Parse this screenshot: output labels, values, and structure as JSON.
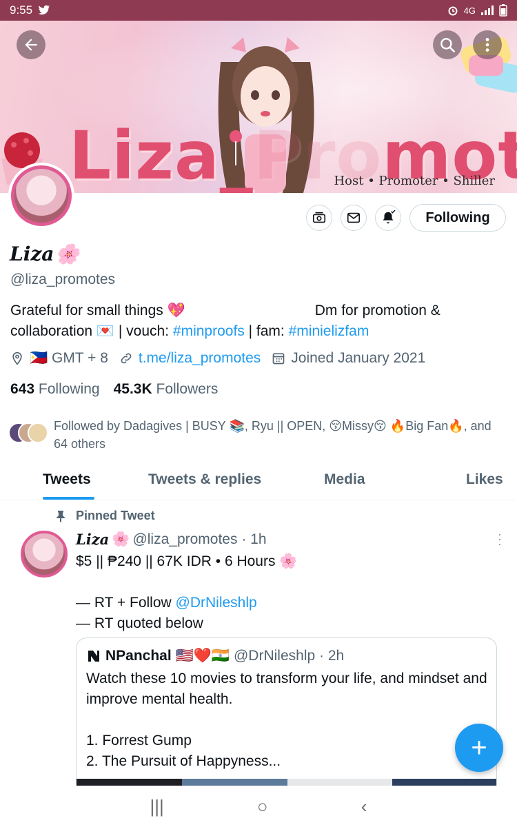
{
  "status_bar": {
    "time": "9:55",
    "network": "4G",
    "colors": {
      "bar": "#8e3a52"
    }
  },
  "banner": {
    "title": "Liza_Promotes",
    "title_left": "Liza_",
    "title_right": "motes",
    "tagline": "Host • Promoter • Shiller",
    "icons": [
      "back-arrow-icon",
      "search-icon",
      "more-vertical-icon"
    ]
  },
  "profile": {
    "display_name": "Liza",
    "name_emoji": "🌸",
    "handle": "@liza_promotes",
    "follow_button": "Following",
    "bio": {
      "part1": "Grateful for small things 💖",
      "part2": "Dm for promotion & collaboration 💌 | vouch: ",
      "hashtag1": "#minproofs",
      "part3": " | fam: ",
      "hashtag2": "#minielizfam"
    },
    "location": "🇵🇭 GMT + 8",
    "website": "t.me/liza_promotes",
    "joined": "Joined January 2021",
    "following_count": "643",
    "following_label": "Following",
    "followers_count": "45.3K",
    "followers_label": "Followers",
    "followed_by": "Followed by Dadagives | BUSY 📚, Ryu || OPEN, 😚Missy😚 🔥Big Fan🔥, and 64 others"
  },
  "tabs": [
    {
      "label": "Tweets",
      "active": true
    },
    {
      "label": "Tweets & replies",
      "active": false
    },
    {
      "label": "Media",
      "active": false
    },
    {
      "label": "Likes",
      "active": false
    }
  ],
  "pinned_tweet": {
    "pinned_label": "Pinned Tweet",
    "name": "Liza",
    "name_emoji": "🌸",
    "handle_time": "@liza_promotes · 1h",
    "line1": "$5 || ₱240 || 67K IDR • 6 Hours 🌸",
    "line2_prefix": "— RT + Follow ",
    "mention": "@DrNileshlp",
    "line3": "— RT quoted below",
    "quote": {
      "name": "NPanchal 🇺🇸❤️🇮🇳",
      "handle_time": "@DrNileshlp · 2h",
      "text": "Watch these 10 movies to transform your life, and mindset and improve mental health.\n\n1. Forrest Gump\n2. The Pursuit of Happyness..."
    }
  },
  "fab": {
    "label": "+"
  },
  "nav_bar": {
    "recents": "|||",
    "home": "○",
    "back": "‹"
  },
  "colors": {
    "accent": "#1d9bf0",
    "text": "#0f1419",
    "secondary": "#536471",
    "avatar_ring": "#e05a93",
    "banner_text": "#e04f6f"
  }
}
